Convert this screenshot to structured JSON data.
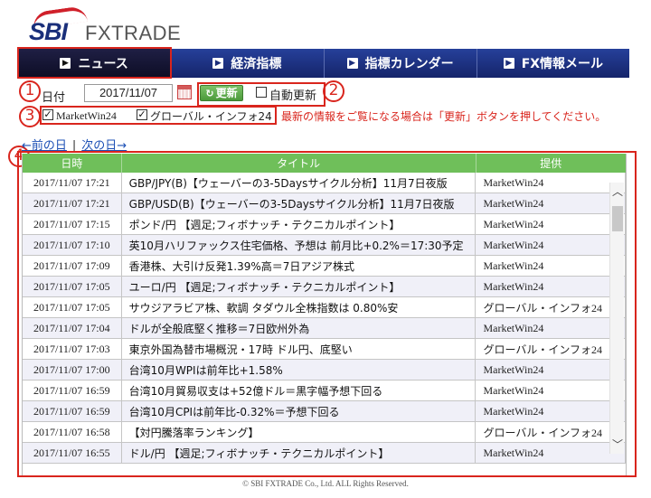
{
  "logo": {
    "brand": "SBI",
    "product": "FXTRADE"
  },
  "nav": [
    {
      "label": "ニュース"
    },
    {
      "label": "経済指標"
    },
    {
      "label": "指標カレンダー"
    },
    {
      "label": "FX情報メール"
    }
  ],
  "annotations": [
    "1",
    "2",
    "3",
    "4"
  ],
  "controls": {
    "date_label": "日付",
    "date_value": "2017/11/07",
    "refresh_label": "更新",
    "auto_refresh_label": "自動更新",
    "auto_refresh_checked": false
  },
  "sources": [
    {
      "label": "MarketWin24",
      "checked": true
    },
    {
      "label": "グローバル・インフォ24",
      "checked": true
    }
  ],
  "notice": "最新の情報をご覧になる場合は「更新」ボタンを押してください。",
  "paging": {
    "prev": "←前の日",
    "separator": "|",
    "next": "次の日→"
  },
  "table": {
    "headers": [
      "日時",
      "タイトル",
      "提供"
    ],
    "rows": [
      [
        "2017/11/07 17:21",
        "GBP/JPY(B)【ウェーバーの3-5Daysサイクル分析】11月7日夜版",
        "MarketWin24"
      ],
      [
        "2017/11/07 17:21",
        "GBP/USD(B)【ウェーバーの3-5Daysサイクル分析】11月7日夜版",
        "MarketWin24"
      ],
      [
        "2017/11/07 17:15",
        "ポンド/円 【週足;フィボナッチ・テクニカルポイント】",
        "MarketWin24"
      ],
      [
        "2017/11/07 17:10",
        "英10月ハリファックス住宅価格、予想は 前月比+0.2%＝17:30予定",
        "MarketWin24"
      ],
      [
        "2017/11/07 17:09",
        "香港株、大引け反発1.39%高＝7日アジア株式",
        "MarketWin24"
      ],
      [
        "2017/11/07 17:05",
        "ユーロ/円 【週足;フィボナッチ・テクニカルポイント】",
        "MarketWin24"
      ],
      [
        "2017/11/07 17:05",
        "サウジアラビア株、軟調 タダウル全株指数は 0.80%安",
        "グローバル・インフォ24"
      ],
      [
        "2017/11/07 17:04",
        "ドルが全般底堅く推移＝7日欧州外為",
        "MarketWin24"
      ],
      [
        "2017/11/07 17:03",
        "東京外国為替市場概況・17時 ドル円、底堅い",
        "グローバル・インフォ24"
      ],
      [
        "2017/11/07 17:00",
        "台湾10月WPIは前年比+1.58%",
        "MarketWin24"
      ],
      [
        "2017/11/07 16:59",
        "台湾10月貿易収支は+52億ドル＝黒字幅予想下回る",
        "MarketWin24"
      ],
      [
        "2017/11/07 16:59",
        "台湾10月CPIは前年比-0.32%＝予想下回る",
        "MarketWin24"
      ],
      [
        "2017/11/07 16:58",
        "【対円騰落率ランキング】",
        "グローバル・インフォ24"
      ],
      [
        "2017/11/07 16:55",
        "ドル/円 【週足;フィボナッチ・テクニカルポイント】",
        "MarketWin24"
      ]
    ]
  },
  "footer": "© SBI FXTRADE Co., Ltd. ALL Rights Reserved."
}
